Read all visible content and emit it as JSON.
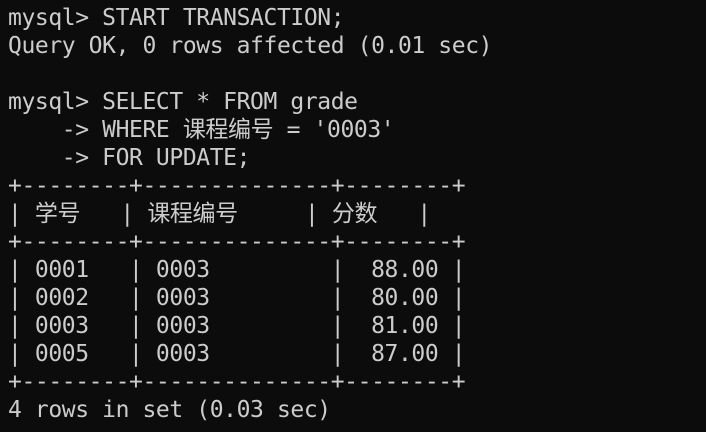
{
  "terminal": {
    "lines": [
      "mysql> START TRANSACTION;",
      "Query OK, 0 rows affected (0.01 sec)",
      "",
      "mysql> SELECT * FROM grade",
      "    -> WHERE 课程编号 = '0003'",
      "    -> FOR UPDATE;",
      "+--------+--------------+--------+",
      "| 学号   | 课程编号     | 分数   |",
      "+--------+--------------+--------+",
      "| 0001   | 0003         |  88.00 |",
      "| 0002   | 0003         |  80.00 |",
      "| 0003   | 0003         |  81.00 |",
      "| 0005   | 0003         |  87.00 |",
      "+--------+--------------+--------+",
      "4 rows in set (0.03 sec)"
    ]
  }
}
